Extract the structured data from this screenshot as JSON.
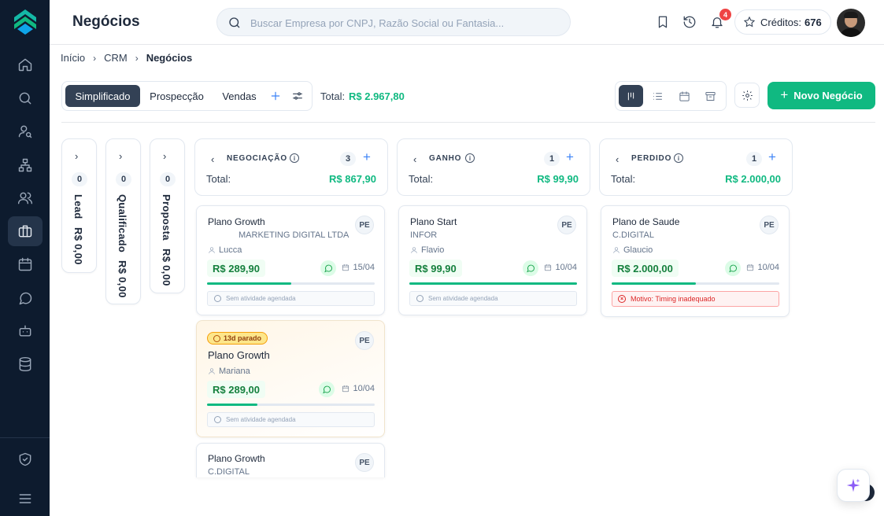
{
  "header": {
    "title": "Negócios",
    "search_placeholder": "Buscar Empresa por CNPJ, Razão Social ou Fantasia...",
    "notification_count": "4",
    "credits_label": "Créditos:",
    "credits_value": "676"
  },
  "breadcrumb": [
    "Início",
    "CRM",
    "Negócios"
  ],
  "tabs": [
    "Simplificado",
    "Prospecção",
    "Vendas"
  ],
  "total": {
    "label": "Total:",
    "value": "R$ 2.967,80"
  },
  "new_button_label": "Novo Negócio",
  "collapsed_columns": [
    {
      "name": "Lead",
      "count": "0",
      "value": "R$ 0,00"
    },
    {
      "name": "Qualificado",
      "count": "0",
      "value": "R$ 0,00"
    },
    {
      "name": "Proposta",
      "count": "0",
      "value": "R$ 0,00"
    }
  ],
  "columns": [
    {
      "name": "NEGOCIAÇÃO",
      "count": "3",
      "total_label": "Total:",
      "total_value": "R$ 867,90",
      "cards": [
        {
          "title": "Plano Growth",
          "company": "MARKETING DIGITAL LTDA",
          "initials": "PE",
          "person": "Lucca",
          "value": "R$ 289,90",
          "date": "15/04",
          "progress": 0.5,
          "activity": "Sem atividade agendada"
        },
        {
          "badge": "13d parado",
          "title": "Plano Growth",
          "initials": "PE",
          "person": "Mariana",
          "value": "R$ 289,00",
          "date": "10/04",
          "progress": 0.3,
          "activity": "Sem atividade agendada"
        },
        {
          "title": "Plano Growth",
          "company": "C.DIGITAL",
          "initials": "PE"
        }
      ]
    },
    {
      "name": "GANHO",
      "count": "1",
      "total_label": "Total:",
      "total_value": "R$ 99,90",
      "cards": [
        {
          "title": "Plano Start",
          "company": "INFOR",
          "initials": "PE",
          "person": "Flavio",
          "value": "R$ 99,90",
          "date": "10/04",
          "progress": 1.0,
          "activity": "Sem atividade agendada"
        }
      ]
    },
    {
      "name": "PERDIDO",
      "count": "1",
      "total_label": "Total:",
      "total_value": "R$ 2.000,00",
      "cards": [
        {
          "title": "Plano de Saude",
          "company": "C.DIGITAL",
          "initials": "PE",
          "person": "Glaucio",
          "value": "R$ 2.000,00",
          "date": "10/04",
          "progress": 0.5,
          "reason": "Motivo: Timing inadequado"
        }
      ]
    }
  ],
  "colors": {
    "accent": "#10b981",
    "sidebar": "#0d1b2e",
    "danger": "#ef4444",
    "active_tab": "#334155"
  }
}
